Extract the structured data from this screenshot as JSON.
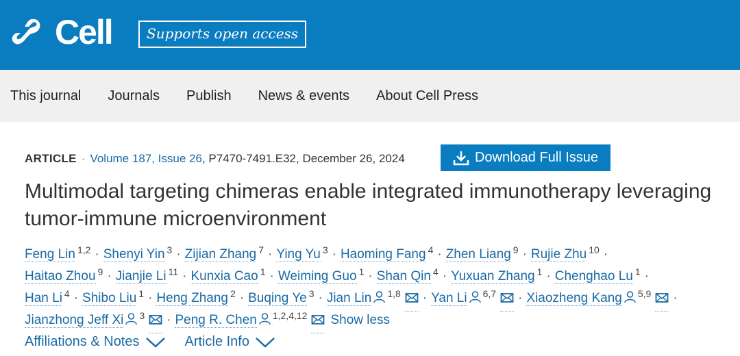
{
  "header": {
    "brand": "Cell",
    "open_access_label": "Supports open access",
    "brand_color": "#0a7dc1"
  },
  "nav": {
    "items": [
      "This journal",
      "Journals",
      "Publish",
      "News & events",
      "About Cell Press"
    ]
  },
  "article": {
    "type": "ARTICLE",
    "separator": "·",
    "volume_issue": "Volume 187, Issue 26",
    "pages_date": ", P7470-7491.E32, December 26, 2024",
    "download_label": "Download Full Issue",
    "download_icon": "download-icon",
    "title": "Multimodal targeting chimeras enable integrated immunotherapy leveraging tumor-immune microenvironment"
  },
  "authors": {
    "rows": [
      [
        {
          "name": "Feng Lin",
          "sup": "1,2"
        },
        {
          "name": "Shenyi Yin",
          "sup": "3"
        },
        {
          "name": "Zijian Zhang",
          "sup": "7"
        },
        {
          "name": "Ying Yu",
          "sup": "3"
        },
        {
          "name": "Haoming Fang",
          "sup": "4"
        },
        {
          "name": "Zhen Liang",
          "sup": "9"
        },
        {
          "name": "Rujie Zhu",
          "sup": "10"
        }
      ],
      [
        {
          "name": "Haitao Zhou",
          "sup": "9"
        },
        {
          "name": "Jianjie Li",
          "sup": "11"
        },
        {
          "name": "Kunxia Cao",
          "sup": "1"
        },
        {
          "name": "Weiming Guo",
          "sup": "1"
        },
        {
          "name": "Shan Qin",
          "sup": "4"
        },
        {
          "name": "Yuxuan Zhang",
          "sup": "1"
        },
        {
          "name": "Chenghao Lu",
          "sup": "1"
        }
      ],
      [
        {
          "name": "Han Li",
          "sup": "4"
        },
        {
          "name": "Shibo Liu",
          "sup": "1"
        },
        {
          "name": "Heng Zhang",
          "sup": "2"
        },
        {
          "name": "Buqing Ye",
          "sup": "3"
        },
        {
          "name": "Jian Lin",
          "sup": "1,8",
          "corresponding": true
        },
        {
          "name": "Yan Li",
          "sup": "6,7",
          "corresponding": true
        },
        {
          "name": "Xiaozheng Kang",
          "sup": "5,9",
          "corresponding": true
        }
      ],
      [
        {
          "name": "Jianzhong Jeff Xi",
          "sup": "3",
          "corresponding": true
        },
        {
          "name": "Peng R. Chen",
          "sup": "1,2,4,12",
          "corresponding": true
        }
      ]
    ],
    "separator": "·",
    "show_less_label": "Show less"
  },
  "sections": {
    "affiliations_label": "Affiliations & Notes",
    "article_info_label": "Article Info"
  }
}
